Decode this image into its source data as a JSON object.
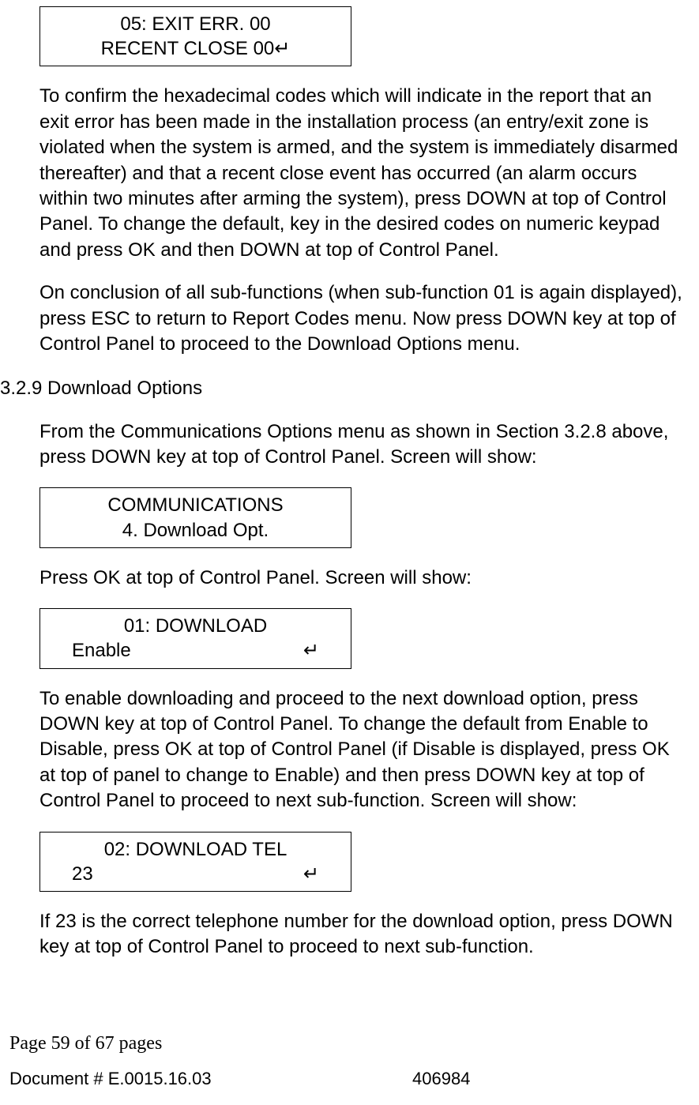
{
  "lcd1": {
    "line1": "05: EXIT ERR. 00",
    "line2": "RECENT CLOSE 00↵"
  },
  "para1": "To confirm the hexadecimal codes which will indicate in the report that an exit error has been made in the installation process (an entry/exit zone is violated when the system is armed, and the system is immediately disarmed thereafter) and that a recent close event has occurred (an alarm occurs within two minutes after arming the system), press DOWN at top of Control Panel. To change the default, key in the desired codes on numeric keypad and press OK and then DOWN at top of Control Panel.",
  "para2": "On conclusion of all sub-functions (when sub-function 01 is again displayed), press ESC to return to Report Codes menu. Now press DOWN key at top of Control Panel to proceed to the Download Options menu.",
  "section": {
    "number": "3.2.9",
    "title": "Download Options"
  },
  "para3": "From the Communications Options menu as shown in Section 3.2.8 above, press DOWN key at top of Control Panel. Screen will show:",
  "lcd2": {
    "line1": "COMMUNICATIONS",
    "line2": "4. Download Opt."
  },
  "para4": "Press OK at top of Control Panel. Screen will show:",
  "lcd3": {
    "line1": "01: DOWNLOAD",
    "left": "Enable",
    "right": "↵"
  },
  "para5": "To enable downloading and proceed to the next download option, press DOWN key at top of Control Panel. To change the default from Enable to Disable, press OK at top of Control Panel (if Disable is displayed, press OK at top of panel to change to Enable) and then press DOWN key at top of Control Panel to proceed to next sub-function. Screen will show:",
  "lcd4": {
    "line1": "02: DOWNLOAD TEL",
    "left": "23",
    "right": "↵"
  },
  "para6": "If 23 is the correct telephone number for the download option, press DOWN key at top of Control Panel to proceed to next sub-function.",
  "footer": {
    "page": "Page 59 of  67 pages",
    "docid": "Document # E.0015.16.03",
    "code": "406984"
  }
}
